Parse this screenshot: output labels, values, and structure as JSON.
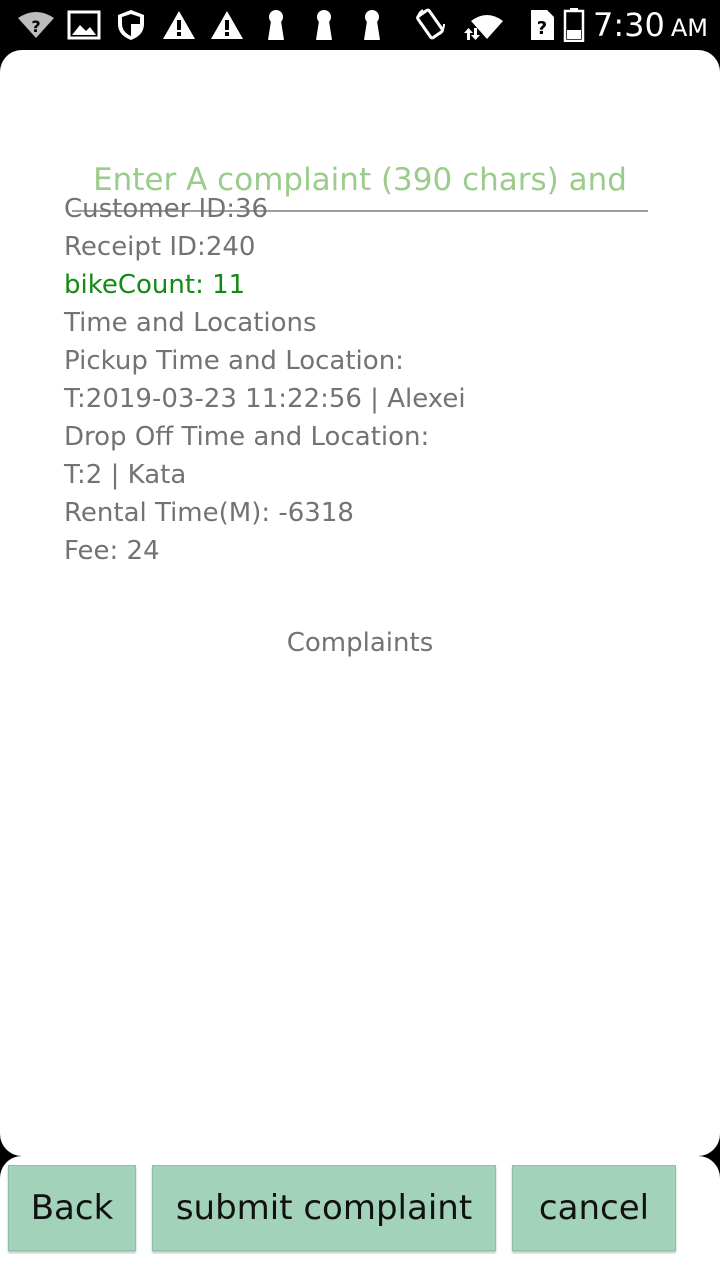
{
  "status_bar": {
    "time": "7:30",
    "ampm": "AM",
    "icons": [
      "wifi-question-icon",
      "image-icon",
      "shield-icon",
      "warning-icon",
      "warning-icon",
      "keyhole-icon",
      "keyhole-icon",
      "keyhole-icon",
      "rotate-icon",
      "wifi-icon",
      "sim-question-icon",
      "battery-icon"
    ]
  },
  "complaint_input": {
    "placeholder": "Enter A complaint (390 chars) and"
  },
  "info": {
    "customer_id": "Customer ID:36",
    "receipt_id": "Receipt ID:240",
    "bike_count": "bikeCount: 11",
    "time_and_locations": "Time and Locations",
    "pickup_label": "Pickup Time and Location:",
    "pickup_value": "T:2019-03-23 11:22:56 | Alexei",
    "dropoff_label": "Drop Off Time and Location:",
    "dropoff_value": "T:2 | Kata",
    "rental_time": "Rental Time(M): -6318",
    "fee": "Fee: 24"
  },
  "complaints_heading": "Complaints",
  "buttons": {
    "back": "Back",
    "submit": "submit complaint",
    "cancel": "cancel"
  },
  "colors": {
    "accent_green": "#9ccc8c",
    "bike_count_green": "#138a13",
    "button_bg": "#a3d2bb"
  }
}
